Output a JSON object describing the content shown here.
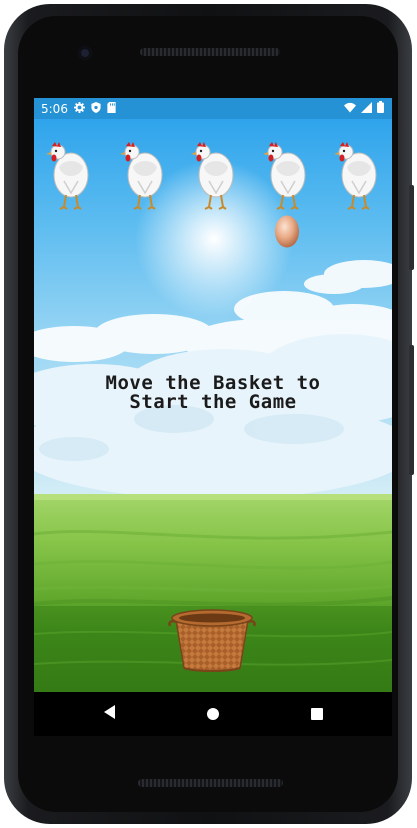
{
  "status_bar": {
    "time": "5:06",
    "left_icons": [
      "gear-icon",
      "shield-icon",
      "sd-card-icon"
    ],
    "right_icons": [
      "wifi-icon",
      "signal-icon",
      "battery-icon"
    ],
    "background_color": "#2492d4"
  },
  "game": {
    "message_line_1": "Move the Basket to",
    "message_line_2": "Start the Game",
    "chicken_count": 5,
    "falling_egg_count": 1
  },
  "colors": {
    "sky_top": "#2fa4ec",
    "grass": "#7cbe3c",
    "basket": "#c47a3c"
  },
  "nav_bar": {
    "buttons": [
      "back-icon",
      "home-icon",
      "recents-icon"
    ]
  }
}
